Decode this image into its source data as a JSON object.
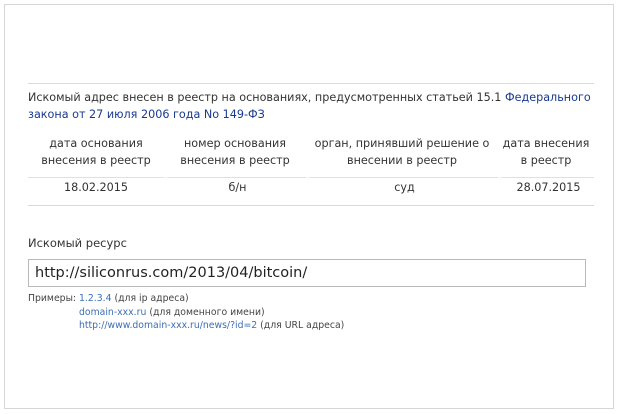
{
  "registry": {
    "intro_text": "Искомый адрес внесен в реестр на основаниях, предусмотренных статьей 15.1 ",
    "intro_link": "Федерального закона от 27 июля 2006 года No 149-ФЗ",
    "columns": [
      "дата основания внесения в реестр",
      "номер основания внесения в реестр",
      "орган, принявший решение о внесении в реестр",
      "дата внесения в реестр"
    ],
    "row": [
      "18.02.2015",
      "б/н",
      "суд",
      "28.07.2015"
    ]
  },
  "resource": {
    "label": "Искомый ресурс",
    "value": "http://siliconrus.com/2013/04/bitcoin/"
  },
  "examples": {
    "label": "Примеры:",
    "items": [
      {
        "link": "1.2.3.4",
        "note": "(для ip адреса)"
      },
      {
        "link": "domain-xxx.ru",
        "note": "(для доменного имени)"
      },
      {
        "link": "http://www.domain-xxx.ru/news/?id=2",
        "note": "(для URL адреса)"
      }
    ]
  }
}
